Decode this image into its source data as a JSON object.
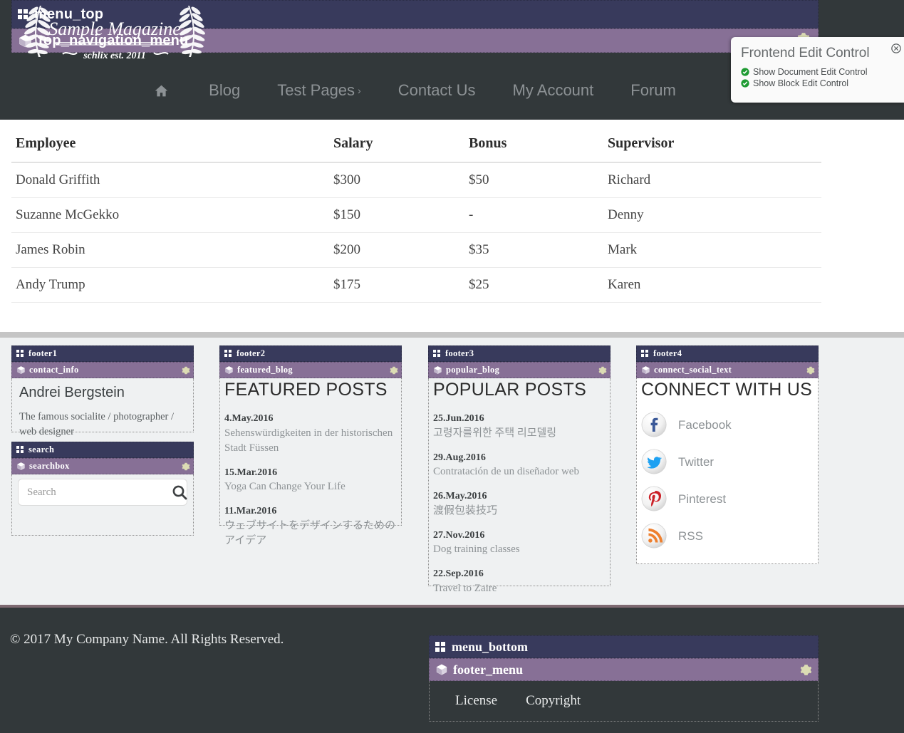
{
  "colors": {
    "container_header": "#383a5c",
    "block_header": "#877096",
    "dark_chrome": "#32383a",
    "footer_bg": "#eff1f2",
    "gear": "#dcdcb4",
    "check_green": "#1f9b33",
    "facebook": "#3b5998",
    "twitter": "#1da1f2",
    "pinterest": "#cb2027",
    "rss": "#ee802f"
  },
  "header": {
    "menu_top_container": "menu_top",
    "top_navigation_block": "top_navigation_menu",
    "logo": {
      "title": "Sample Magazine",
      "subtitle": "schlix est. 2011",
      "icon": "laurel-wreath-emblem"
    },
    "nav": [
      {
        "label": "",
        "icon": "home-icon",
        "caret": ""
      },
      {
        "label": "Blog",
        "icon": "",
        "caret": ""
      },
      {
        "label": "Test Pages",
        "icon": "",
        "caret": "›"
      },
      {
        "label": "Contact Us",
        "icon": "",
        "caret": ""
      },
      {
        "label": "My Account",
        "icon": "",
        "caret": ""
      },
      {
        "label": "Forum",
        "icon": "",
        "caret": ""
      }
    ]
  },
  "frontend_edit_control": {
    "title": "Frontend Edit Control",
    "close_icon": "close-circle-icon",
    "options": [
      {
        "label": "Show Document Edit Control",
        "icon": "check-circle-icon",
        "checked": true
      },
      {
        "label": "Show Block Edit Control",
        "icon": "check-circle-icon",
        "checked": true
      }
    ]
  },
  "table": {
    "headers": [
      "Employee",
      "Salary",
      "Bonus",
      "Supervisor"
    ],
    "rows": [
      [
        "Donald Griffith",
        "$300",
        "$50",
        "Richard"
      ],
      [
        "Suzanne McGekko",
        "$150",
        "-",
        "Denny"
      ],
      [
        "James Robin",
        "$200",
        "$35",
        "Mark"
      ],
      [
        "Andy Trump",
        "$175",
        "$25",
        "Karen"
      ]
    ]
  },
  "footer": {
    "col1": {
      "container": "footer1",
      "block": "contact_info",
      "gear_icon": "gear-icon",
      "name": "Andrei Bergstein",
      "description": "The famous socialite / photographer / web designer",
      "search_container": "search",
      "search_block": "searchbox",
      "search_gear_icon": "gear-icon",
      "search_placeholder": "Search",
      "search_value": "",
      "search_icon": "search-icon"
    },
    "col2": {
      "container": "footer2",
      "block": "featured_blog",
      "gear_icon": "gear-icon",
      "title": "FEATURED POSTS",
      "posts": [
        {
          "date": "4.May.2016",
          "title": "Sehenswürdigkeiten in der historischen Stadt Füssen"
        },
        {
          "date": "15.Mar.2016",
          "title": "Yoga Can Change Your Life"
        },
        {
          "date": "11.Mar.2016",
          "title": "ウェブサイトをデザインするためのアイデア"
        }
      ]
    },
    "col3": {
      "container": "footer3",
      "block": "popular_blog",
      "gear_icon": "gear-icon",
      "title": "POPULAR POSTS",
      "posts": [
        {
          "date": "25.Jun.2016",
          "title": "고령자를위한 주택 리모델링"
        },
        {
          "date": "29.Aug.2016",
          "title": "Contratación de un diseñador web"
        },
        {
          "date": "26.May.2016",
          "title": "渡假包装技巧"
        },
        {
          "date": "27.Nov.2016",
          "title": "Dog training classes"
        },
        {
          "date": "22.Sep.2016",
          "title": "Travel to Zaire"
        }
      ]
    },
    "col4": {
      "container": "footer4",
      "block": "connect_social_text",
      "gear_icon": "gear-icon",
      "title": "CONNECT WITH US",
      "socials": [
        {
          "label": "Facebook",
          "icon": "facebook-icon"
        },
        {
          "label": "Twitter",
          "icon": "twitter-icon"
        },
        {
          "label": "Pinterest",
          "icon": "pinterest-icon"
        },
        {
          "label": "RSS",
          "icon": "rss-icon"
        }
      ]
    }
  },
  "bottom": {
    "copyright": "© 2017 My Company Name. All Rights Reserved.",
    "menu_container": "menu_bottom",
    "menu_block": "footer_menu",
    "gear_icon": "gear-icon",
    "items": [
      "License",
      "Copyright"
    ]
  }
}
